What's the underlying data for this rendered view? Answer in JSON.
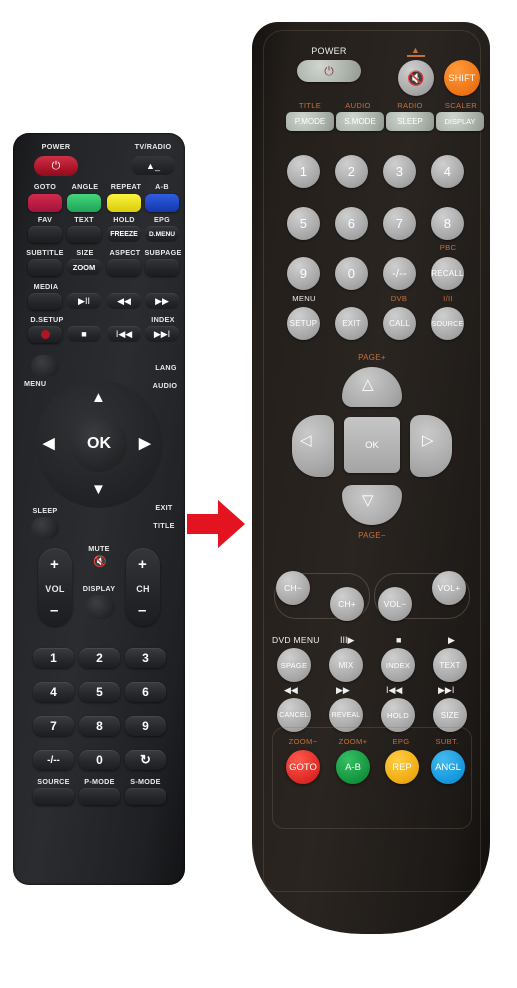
{
  "scene": {
    "title": "Remote control replacement comparison",
    "arrow": {
      "name": "red-right-arrow",
      "color": "#e3131f"
    }
  },
  "left_remote": {
    "name": "original-remote",
    "power": {
      "label": "POWER",
      "icon": "power-icon",
      "color": "#b31427"
    },
    "tv_radio": {
      "label": "TV/RADIO",
      "icon": "eject-icon"
    },
    "color_row_top": [
      "GOTO",
      "ANGLE",
      "REPEAT",
      "A-B"
    ],
    "color_buttons": [
      {
        "label": "FAV",
        "color": "#c2183f"
      },
      {
        "label": "TEXT",
        "color": "#2bbd62"
      },
      {
        "label": "HOLD",
        "color": "#f2ea1c"
      },
      {
        "label": "EPG",
        "color": "#1b47c8"
      }
    ],
    "sub_labels": [
      "FREEZE",
      "D.MENU"
    ],
    "row_subtitle": [
      "SUBTITLE",
      "SIZE",
      "ASPECT",
      "SUBPAGE"
    ],
    "zoom_label": "ZOOM",
    "media_label": "MEDIA",
    "media_row": [
      "▶II",
      "◀◀",
      "▶▶"
    ],
    "dsetup_label": "D.SETUP",
    "index_label": "INDEX",
    "transport_row": [
      "■",
      "I◀◀",
      "▶▶I"
    ],
    "menu_label": "MENU",
    "lang_label": "LANG",
    "audio_label": "AUDIO",
    "ok_label": "OK",
    "sleep_label": "SLEEP",
    "exit_label": "EXIT",
    "title_label": "TITLE",
    "mute_label": "MUTE",
    "display_label": "DISPLAY",
    "vol_label": "VOL",
    "ch_label": "CH",
    "plus": "+",
    "minus": "–",
    "numpad": [
      "1",
      "2",
      "3",
      "4",
      "5",
      "6",
      "7",
      "8",
      "9",
      "-/--",
      "0",
      "↻"
    ],
    "bottom_labels": [
      "SOURCE",
      "P-MODE",
      "S-MODE"
    ]
  },
  "right_remote": {
    "name": "replacement-remote",
    "power_label": "POWER",
    "power_icon": "power-icon",
    "eject_icon": "eject-icon",
    "mute_icon": "mute-icon",
    "shift_label": "SHIFT",
    "shift_color": "#f07818",
    "mode_top_labels": [
      "TITLE",
      "AUDIO",
      "RADIO",
      "SCALER"
    ],
    "mode_buttons": [
      "P.MODE",
      "S.MODE",
      "SLEEP",
      "DISPLAY"
    ],
    "numpad": [
      "1",
      "2",
      "3",
      "4",
      "5",
      "6",
      "7",
      "8",
      "9",
      "0",
      "-/--",
      "RECALL"
    ],
    "pbc_label": "PBC",
    "menu_label": "MENU",
    "dvb_label": "DVB",
    "i_ii_label": "I/II",
    "func_row": [
      "SETUP",
      "EXIT",
      "CALL",
      "SOURCE"
    ],
    "page_plus": "PAGE+",
    "page_minus": "PAGE−",
    "ok_label": "OK",
    "ch_minus": "CH−",
    "ch_plus": "CH+",
    "vol_minus": "VOL−",
    "vol_plus": "VOL+",
    "dvd_menu_label": "DVD MENU",
    "teletext_icons": [
      "III▶",
      "■",
      "▶"
    ],
    "teletext_row1": [
      "SPAGE",
      "MIX",
      "INDEX",
      "TEXT"
    ],
    "transport_icons": [
      "◀◀",
      "▶▶",
      "I◀◀",
      "▶▶I"
    ],
    "teletext_row2": [
      "CANCEL",
      "REVEAL",
      "HOLD",
      "SIZE"
    ],
    "color_top_labels": [
      "ZOOM−",
      "ZOOM+",
      "EPG",
      "SUBT."
    ],
    "color_buttons": [
      {
        "label": "GOTO",
        "color": "#e02b26"
      },
      {
        "label": "A-B",
        "color": "#16963f"
      },
      {
        "label": "REP",
        "color": "#f0ae14"
      },
      {
        "label": "ANGL",
        "color": "#169ade"
      }
    ]
  }
}
